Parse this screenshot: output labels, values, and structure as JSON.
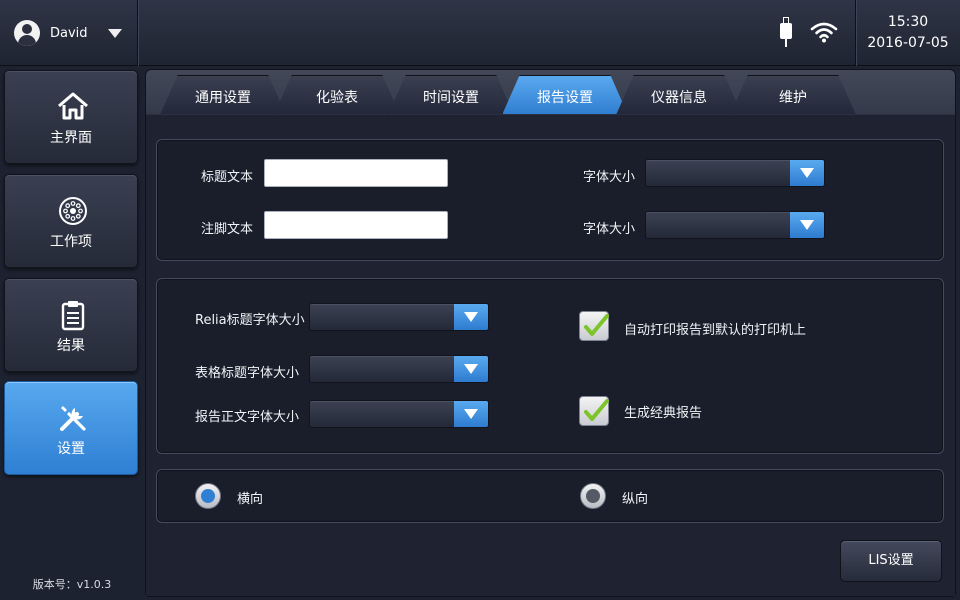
{
  "user": {
    "name": "David"
  },
  "status": {
    "time": "15:30",
    "date": "2016-07-05",
    "icons": [
      "usb-icon",
      "wifi-icon"
    ]
  },
  "sidebar": {
    "items": [
      {
        "label": "主界面",
        "icon": "home-icon",
        "active": false
      },
      {
        "label": "工作项",
        "icon": "work-items-icon",
        "active": false
      },
      {
        "label": "结果",
        "icon": "clipboard-icon",
        "active": false
      },
      {
        "label": "设置",
        "icon": "tools-icon",
        "active": true
      }
    ],
    "version": "版本号：v1.0.3"
  },
  "tabs": [
    {
      "label": "通用设置",
      "active": false
    },
    {
      "label": "化验表",
      "active": false
    },
    {
      "label": "时间设置",
      "active": false
    },
    {
      "label": "报告设置",
      "active": true
    },
    {
      "label": "仪器信息",
      "active": false
    },
    {
      "label": "维护",
      "active": false
    }
  ],
  "report": {
    "title_text_label": "标题文本",
    "title_text_value": "",
    "footer_text_label": "注脚文本",
    "footer_text_value": "",
    "font_size_label_1": "字体大小",
    "font_size_value_1": "",
    "font_size_label_2": "字体大小",
    "font_size_value_2": "",
    "relia_title_font_label": "Relia标题字体大小",
    "relia_title_font_value": "",
    "table_title_font_label": "表格标题字体大小",
    "table_title_font_value": "",
    "body_font_label": "报告正文字体大小",
    "body_font_value": "",
    "auto_print_label": "自动打印报告到默认的打印机上",
    "auto_print_checked": true,
    "classic_report_label": "生成经典报告",
    "classic_report_checked": true,
    "orientation_landscape_label": "横向",
    "orientation_portrait_label": "纵向",
    "orientation_selected": "横向"
  },
  "buttons": {
    "lis_settings": "LIS设置"
  },
  "colors": {
    "accent": "#3a8ee0",
    "panel": "#1e2231",
    "check": "#7dc42a",
    "radio_selected": "#2f7fd3",
    "radio_unselected": "#555a66"
  }
}
